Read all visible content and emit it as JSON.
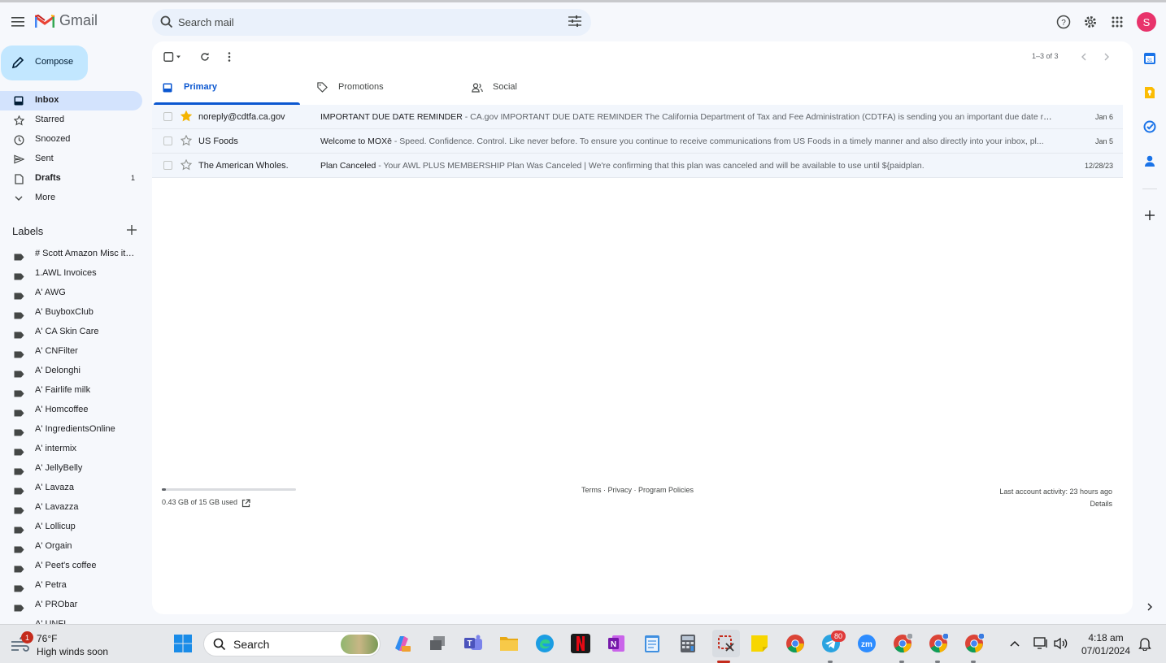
{
  "app": {
    "name": "Gmail"
  },
  "search": {
    "placeholder": "Search mail"
  },
  "user": {
    "avatar_letter": "S"
  },
  "compose": {
    "label": "Compose"
  },
  "nav": [
    {
      "label": "Inbox",
      "icon": "inbox-icon",
      "active": true,
      "bold": true,
      "count": ""
    },
    {
      "label": "Starred",
      "icon": "star-icon",
      "count": ""
    },
    {
      "label": "Snoozed",
      "icon": "clock-icon",
      "count": ""
    },
    {
      "label": "Sent",
      "icon": "send-icon",
      "count": ""
    },
    {
      "label": "Drafts",
      "icon": "draft-icon",
      "bold": true,
      "count": "1"
    },
    {
      "label": "More",
      "icon": "chevron-down-icon",
      "count": ""
    }
  ],
  "labels": {
    "title": "Labels",
    "items": [
      "# Scott Amazon Misc ite...",
      "1.AWL Invoices",
      "A' AWG",
      "A' BuyboxClub",
      "A' CA Skin Care",
      "A' CNFilter",
      "A' Delonghi",
      "A' Fairlife milk",
      "A' Homcoffee",
      "A' IngredientsOnline",
      "A' intermix",
      "A' JellyBelly",
      "A' Lavaza",
      "A' Lavazza",
      "A' Lollicup",
      "A' Orgain",
      "A' Peet's coffee",
      "A' Petra",
      "A' PRObar",
      "A' UNFI"
    ]
  },
  "toolbar": {
    "pager": "1–3 of 3"
  },
  "tabs": [
    {
      "label": "Primary",
      "icon": "inbox-icon",
      "active": true
    },
    {
      "label": "Promotions",
      "icon": "tag-icon"
    },
    {
      "label": "Social",
      "icon": "people-icon"
    }
  ],
  "emails": [
    {
      "sender": "noreply@cdtfa.ca.gov",
      "subject": "IMPORTANT DUE DATE REMINDER",
      "snippet": " - CA.gov IMPORTANT DUE DATE REMINDER The California Department of Tax and Fee Administration (CDTFA) is sending you an important due date remin...",
      "date": "Jan 6",
      "starred": true
    },
    {
      "sender": "US Foods",
      "subject": "Welcome to MOXē",
      "snippet": " - Speed. Confidence. Control. Like never before. To ensure you continue to receive communications from US Foods in a timely manner and also directly into your inbox, pl...",
      "date": "Jan 5",
      "starred": false
    },
    {
      "sender": "The American Wholes.",
      "subject": "Plan Canceled",
      "snippet": " - Your AWL PLUS MEMBERSHIP Plan Was Canceled | We're confirming that this plan was canceled and will be available to use until ${paidplan.",
      "date": "12/28/23",
      "starred": false
    }
  ],
  "footer": {
    "storage": "0.43 GB of 15 GB used",
    "storage_fraction": 0.029,
    "links": "Terms · Privacy · Program Policies",
    "activity": "Last account activity: 23 hours ago",
    "details": "Details"
  },
  "taskbar": {
    "weather_badge": "1",
    "temperature": "76°F",
    "weather_text": "High winds soon",
    "search_label": "Search",
    "telegram_badge": "80",
    "time": "4:18 am",
    "date": "07/01/2024"
  },
  "colors": {
    "accent": "#0b57d0",
    "compose_bg": "#c2e7ff",
    "active_nav": "#d3e3fd",
    "star": "#f4b400",
    "avatar": "#e8336b"
  }
}
